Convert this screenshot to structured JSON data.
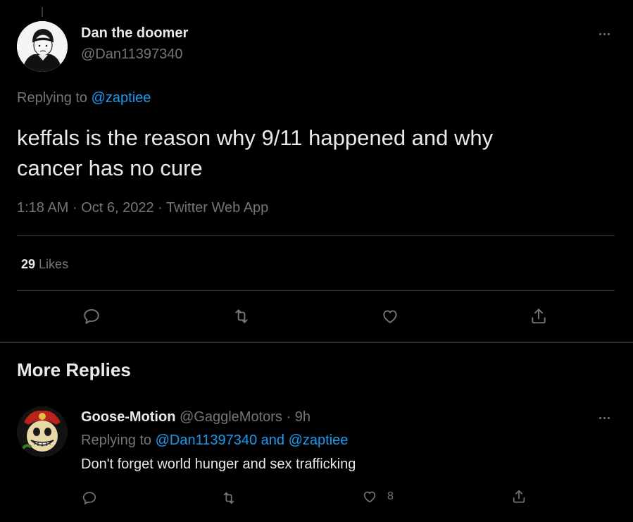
{
  "main_tweet": {
    "author_name": "Dan the doomer",
    "handle": "@Dan11397340",
    "replying_prefix": "Replying to",
    "replying_to": "@zaptiee",
    "text_line1": "keffals is the reason why 9/11 happened and why",
    "text_line2": "cancer has no cure",
    "time": "1:18 AM",
    "date": "Oct 6, 2022",
    "source": "Twitter Web App",
    "sep": "·",
    "likes_count": "29",
    "likes_label": "Likes"
  },
  "more_replies": {
    "heading": "More Replies"
  },
  "reply": {
    "author_name": "Goose-Motion",
    "handle": "@GaggleMotors",
    "sep": "·",
    "time": "9h",
    "replying_prefix": "Replying to",
    "replying_to": "@Dan11397340 and @zaptiee",
    "text": "Don't forget world hunger and sex trafficking",
    "like_count": "8"
  },
  "icons": [
    "reply-icon",
    "retweet-icon",
    "like-icon",
    "share-icon",
    "more-icon"
  ],
  "colors": {
    "background": "#000000",
    "link": "#1d9bf0",
    "muted": "#71767b",
    "divider": "#2f3336"
  }
}
